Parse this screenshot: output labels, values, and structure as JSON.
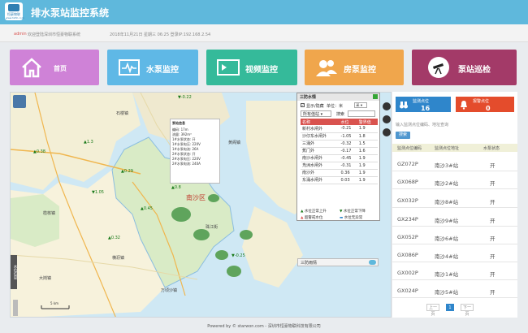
{
  "header": {
    "logo_text": "恒豪物联",
    "logo_sub": "www.hzhh.com",
    "title": "排水泵站监控系统"
  },
  "infobar": {
    "user": "admin",
    "welcome": "欢迎登陆深圳市恒豪物联系统",
    "datetime": "2018年11月21日 星期三 06:25 登录IP:192.168.2.54"
  },
  "nav": [
    {
      "label": "首页",
      "color": "#cf82d7"
    },
    {
      "label": "水泵监控",
      "color": "#5fb8e6"
    },
    {
      "label": "视频监控",
      "color": "#35ba9a"
    },
    {
      "label": "房泵监控",
      "color": "#f0a64c"
    },
    {
      "label": "泵站巡检",
      "color": "#a33a68"
    }
  ],
  "map": {
    "district": "南沙区",
    "places": [
      "石楼镇",
      "榄核镇",
      "黄阁镇",
      "万顷沙镇",
      "横沥镇",
      "珠江街",
      "大岗镇"
    ],
    "scale": "5 km",
    "side_tab": "水位信息",
    "gauges": [
      "-0.22",
      "0.38",
      "1.3",
      "0.29",
      "0.8",
      "-0.25",
      "0.45",
      "0.32",
      "1.05"
    ],
    "popup_title": "泵站信息",
    "popup_rows": [
      "编码: 17m",
      "流量: 392m³",
      "1#水泵状态: 开",
      "1#水泵电压: 220V",
      "1#水泵电流: 26A",
      "2#水泵状态: 开",
      "2#水泵电压: 220V",
      "2#水泵电流: 240A"
    ]
  },
  "water_panel": {
    "title": "三防水情",
    "show_label": "显示/隐藏",
    "unit_label": "单位：米",
    "unit_value": "米",
    "filter_select": "所有值站",
    "search_label": "搜索",
    "columns": [
      "名称",
      "水位",
      "警界值"
    ],
    "rows": [
      {
        "name": "新村水闸外",
        "level": "-0.21",
        "warn": "1.9"
      },
      {
        "name": "沙仔东水闸外",
        "level": "-1.05",
        "warn": "1.8"
      },
      {
        "name": "三涌外",
        "level": "-0.32",
        "warn": "1.5"
      },
      {
        "name": "蕉门外",
        "level": "-0.17",
        "warn": "1.6"
      },
      {
        "name": "南沙水闸外",
        "level": "-0.45",
        "warn": "1.9"
      },
      {
        "name": "凫洲水闸外",
        "level": "-0.31",
        "warn": "1.9"
      },
      {
        "name": "南沙外",
        "level": "0.36",
        "warn": "1.9"
      },
      {
        "name": "东涌水闸外",
        "level": "0.03",
        "warn": "1.9"
      }
    ],
    "legend": [
      "水位正常上升",
      "水位正常下降",
      "超警戒水位",
      "水位无异常"
    ],
    "rain_label": "三防雨情"
  },
  "right": {
    "monitor": {
      "label": "监测点位",
      "value": "16",
      "color": "#2f86cb"
    },
    "alarm": {
      "label": "报警点位",
      "value": "0",
      "color": "#e44c2c"
    },
    "search_placeholder": "输入监测点位编码、地址查询",
    "search_button": "搜索",
    "columns": [
      "监测点位编码",
      "监测点位地址",
      "水泵状态"
    ],
    "rows": [
      {
        "code": "GZ072P",
        "addr": "南沙3#站",
        "status": "开"
      },
      {
        "code": "GX068P",
        "addr": "南沙2#站",
        "status": "开"
      },
      {
        "code": "GX032P",
        "addr": "南沙8#站",
        "status": "开"
      },
      {
        "code": "GX234P",
        "addr": "南沙9#站",
        "status": "开"
      },
      {
        "code": "GX052P",
        "addr": "南沙6#站",
        "status": "开"
      },
      {
        "code": "GX086P",
        "addr": "南沙4#站",
        "status": "开"
      },
      {
        "code": "GX002P",
        "addr": "南沙1#站",
        "status": "开"
      },
      {
        "code": "GX024P",
        "addr": "南沙5#站",
        "status": "开"
      }
    ],
    "pager": {
      "prev": "上一页",
      "page": "1",
      "next": "下一页"
    }
  },
  "footer": "Powered by © starwon.com - 深圳市恒豪物联科技有限公司"
}
